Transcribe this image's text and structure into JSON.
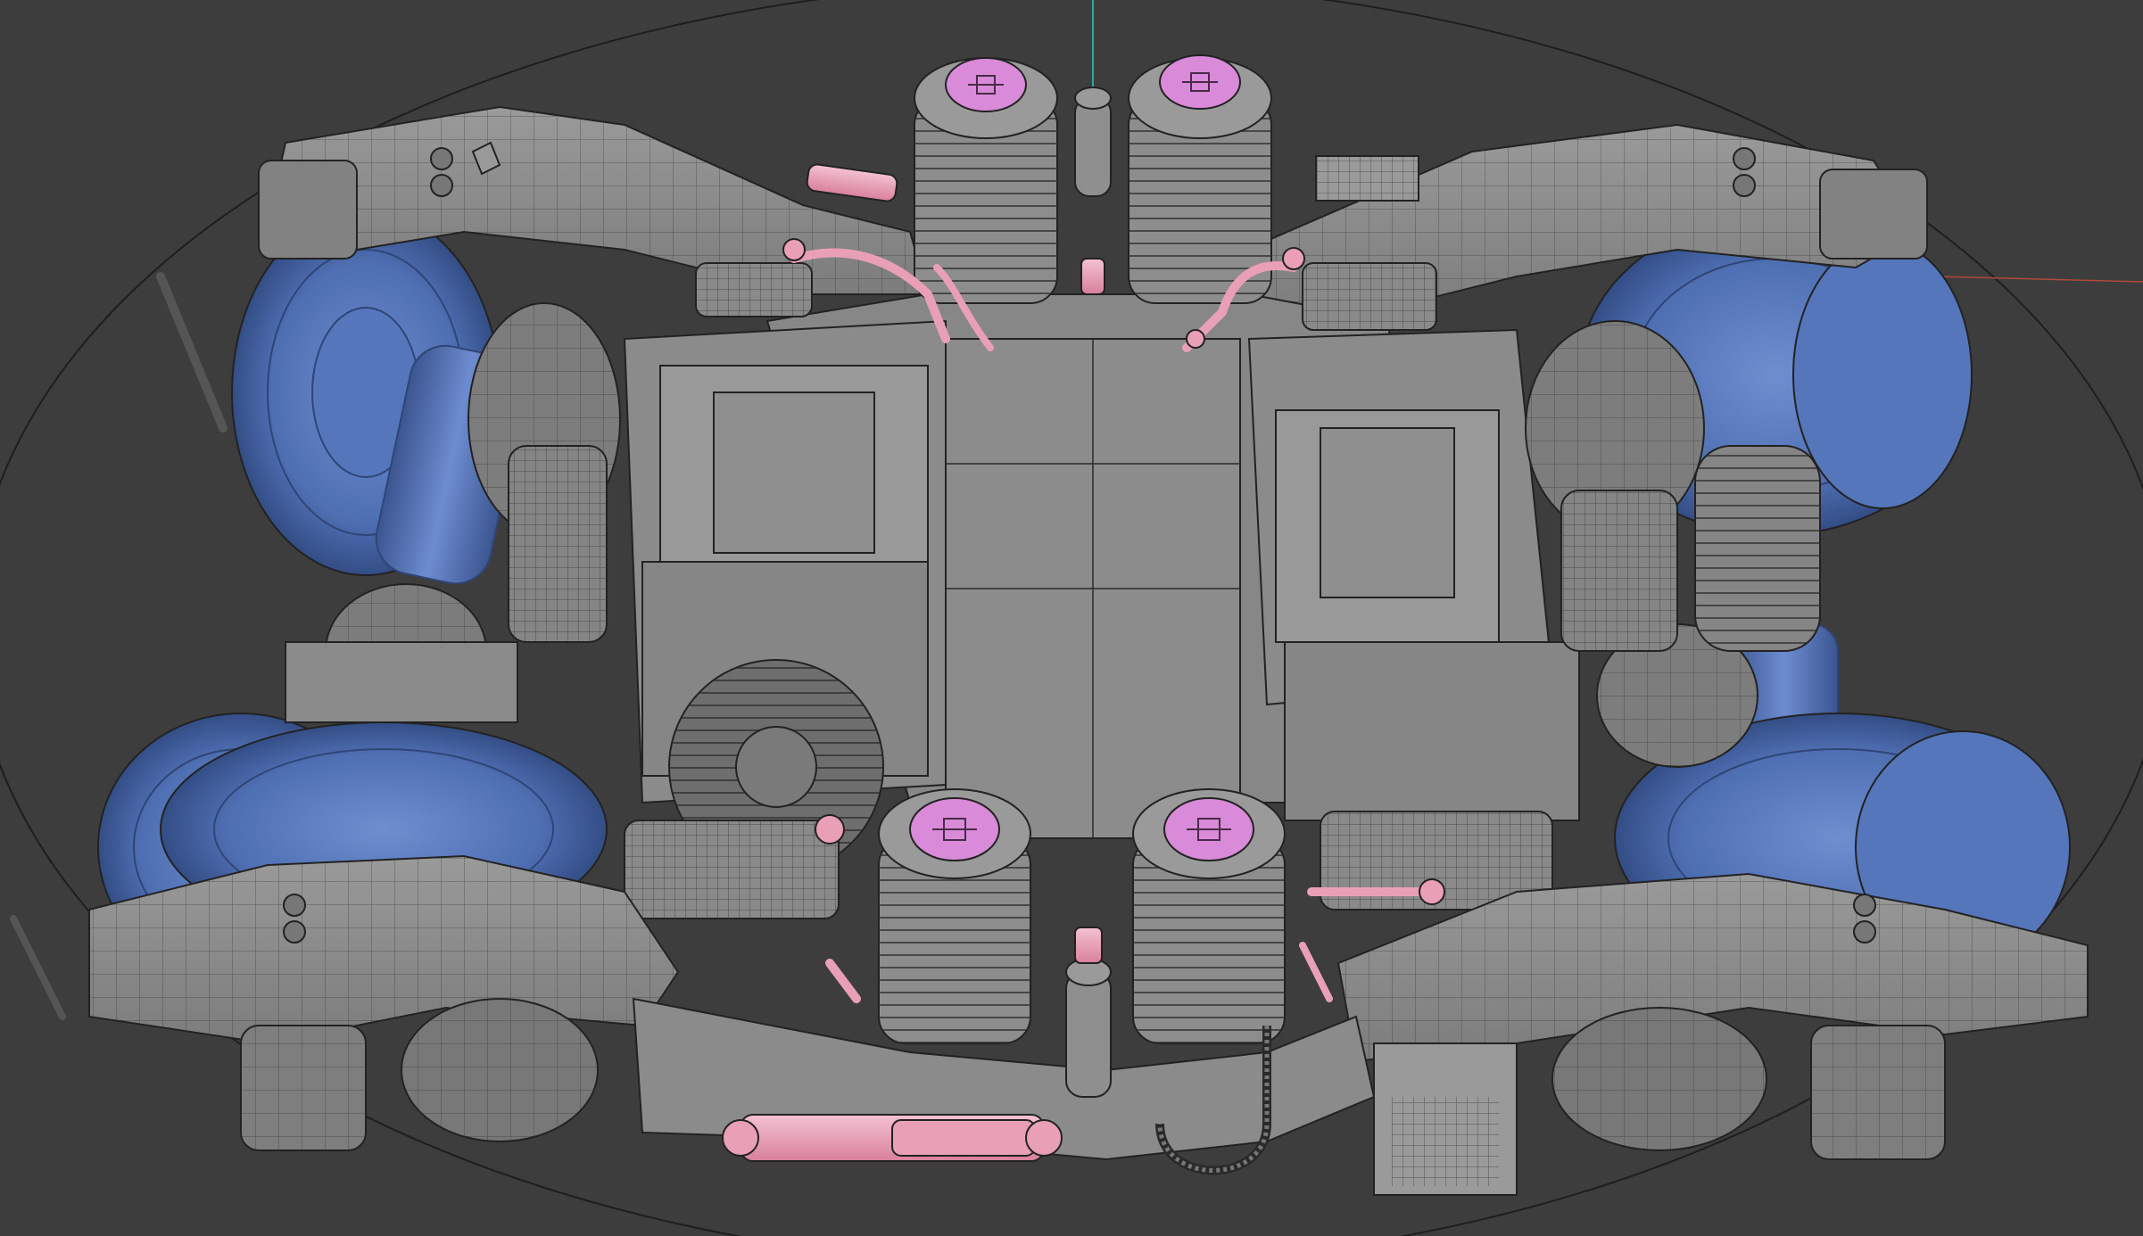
{
  "viewport": {
    "background": "#3d3d3d",
    "gizmo_axis_y_color": "#2aa6a0",
    "gizmo_axis_x_color": "#b04a3a",
    "ground_circle_color": "#1e1e1e"
  },
  "model": {
    "frame_color": "#8e8e8e",
    "frame_dark": "#6f6f6f",
    "wire_color": "#2a2a2a",
    "wheel_color": "#4f6fb3",
    "wheel_dark": "#3b5590",
    "highlight_color": "#e9a0b6",
    "spring_cap_color": "#d98ad8",
    "motor_color": "#8a8a8a"
  }
}
